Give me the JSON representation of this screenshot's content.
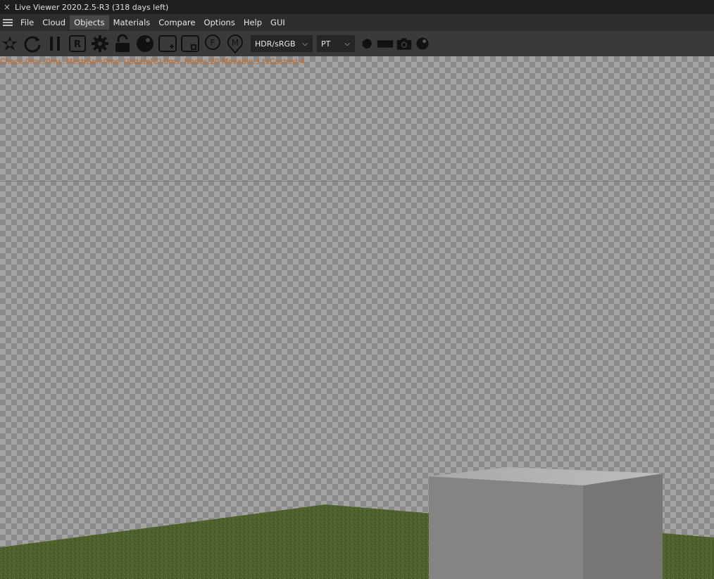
{
  "window": {
    "close_glyph": "×",
    "title": "Live Viewer 2020.2.5-R3 (318 days left)"
  },
  "menu": {
    "items": [
      {
        "label": "File",
        "active": false
      },
      {
        "label": "Cloud",
        "active": false
      },
      {
        "label": "Objects",
        "active": true
      },
      {
        "label": "Materials",
        "active": false
      },
      {
        "label": "Compare",
        "active": false
      },
      {
        "label": "Options",
        "active": false
      },
      {
        "label": "Help",
        "active": false
      },
      {
        "label": "GUI",
        "active": false
      }
    ]
  },
  "toolbar": {
    "icons": [
      "aperture-icon",
      "refresh-icon",
      "pause-icon",
      "render-region-icon",
      "gear-icon",
      "unlock-icon",
      "sphere-icon",
      "add-region-icon",
      "focus-region-icon",
      "focus-pick-icon",
      "material-pick-icon"
    ],
    "tonemap_select": {
      "value": "HDR/sRGB"
    },
    "kernel_select": {
      "value": "PT"
    },
    "trailing_icons": [
      "lens-icon",
      "film-icon",
      "camera-icon",
      "ball-icon"
    ]
  },
  "viewport": {
    "stats_text": "Check:0ms./0ms. MeshGen:0ms. Update[C]:0ms. Nodes:20 Movable:3 txCached:4"
  },
  "colors": {
    "stats_text": "#c8641a",
    "toolbar_bg": "#3a3a3a",
    "menu_active_bg": "#474747",
    "grass": "#4b5d2a",
    "cube_front": "#848583"
  }
}
